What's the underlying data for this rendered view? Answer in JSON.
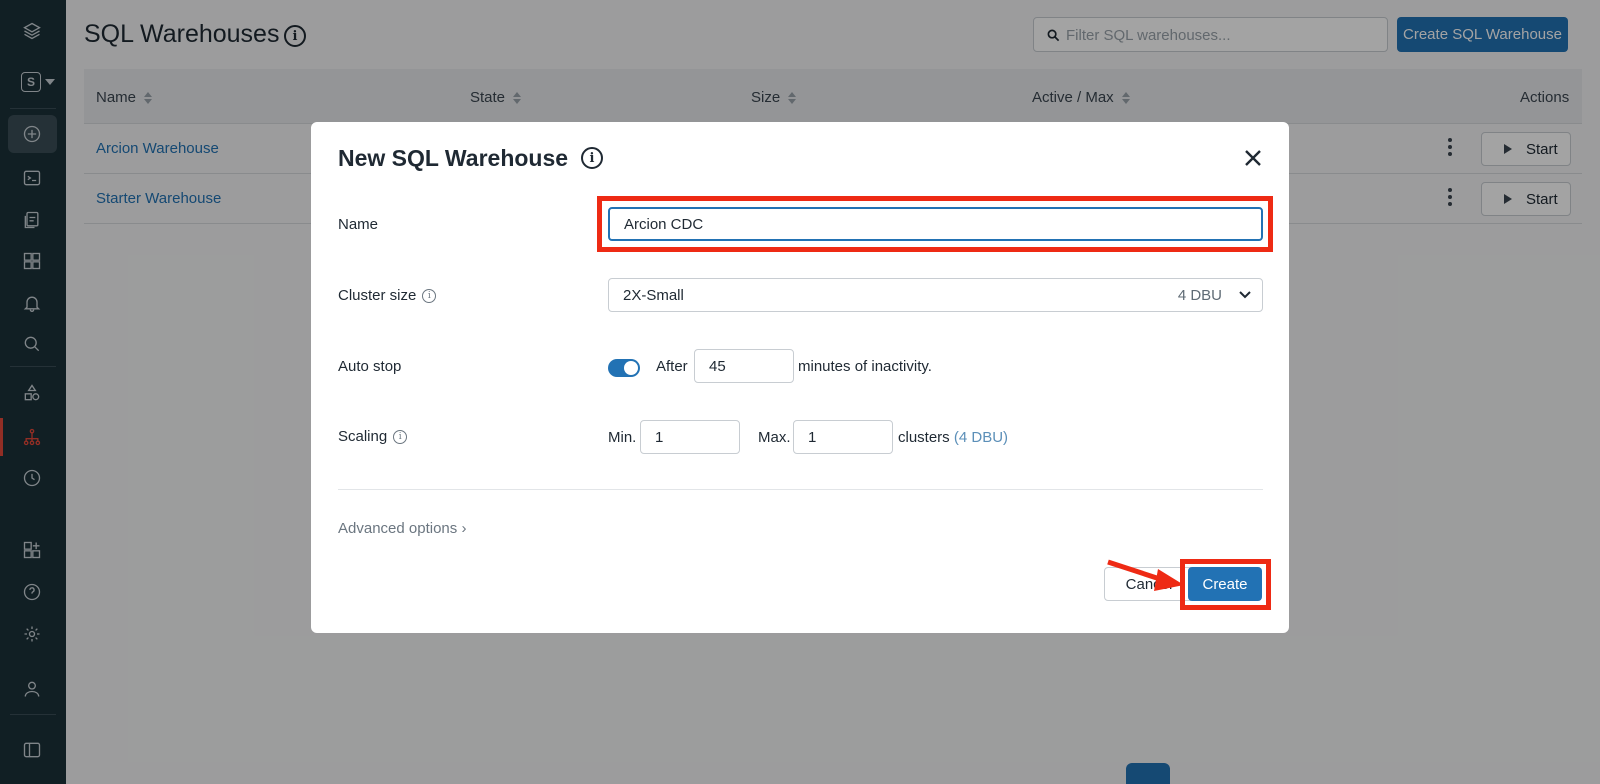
{
  "page": {
    "title": "SQL Warehouses",
    "title_info": "i",
    "filter_placeholder": "Filter SQL warehouses...",
    "create_button": "Create SQL Warehouse"
  },
  "sidebar": {
    "workspace_letter": "S"
  },
  "table": {
    "columns": [
      "Name",
      "State",
      "Size",
      "Active / Max",
      "Actions"
    ],
    "rows": [
      {
        "name": "Arcion Warehouse",
        "action": "Start"
      },
      {
        "name": "Starter Warehouse",
        "action": "Start"
      }
    ]
  },
  "modal": {
    "title": "New SQL Warehouse",
    "title_info": "i",
    "name_label": "Name",
    "name_value": "Arcion CDC",
    "cluster_size_label": "Cluster size",
    "cluster_size_value": "2X-Small",
    "cluster_size_dbu": "4 DBU",
    "auto_stop_label": "Auto stop",
    "auto_stop_enabled": true,
    "after_label": "After",
    "auto_stop_minutes": "45",
    "minutes_suffix": "minutes of inactivity.",
    "scaling_label": "Scaling",
    "min_label": "Min.",
    "min_value": "1",
    "max_label": "Max.",
    "max_value": "1",
    "clusters_label": "clusters",
    "clusters_dbu": "(4 DBU)",
    "advanced_options": "Advanced options",
    "cancel_button": "Cancel",
    "create_button": "Create"
  },
  "colors": {
    "accent": "#2272b4",
    "highlight": "#ee2a14",
    "sidebar": "#1b3139",
    "sidebar_active": "#e5493a"
  }
}
